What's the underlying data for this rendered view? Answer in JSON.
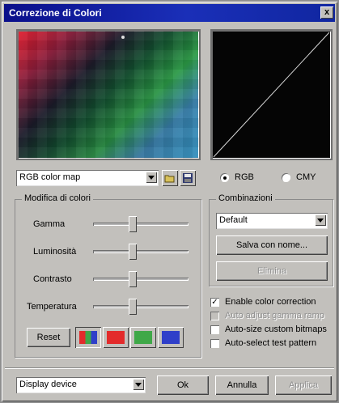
{
  "window": {
    "title": "Correzione di Colori",
    "close_glyph": "x"
  },
  "map_select": {
    "value": "RGB color map"
  },
  "icons": {
    "open": "folder-icon",
    "save": "disk-icon",
    "close": "close-icon",
    "dropdown": "chevron-down-icon"
  },
  "mode": {
    "rgb_label": "RGB",
    "cmy_label": "CMY",
    "selected": "RGB"
  },
  "modifica": {
    "title": "Modifica di colori",
    "sliders": [
      {
        "label": "Gamma",
        "value": 0.5
      },
      {
        "label": "Luminosità",
        "value": 0.5
      },
      {
        "label": "Contrasto",
        "value": 0.5
      },
      {
        "label": "Temperatura",
        "value": 0.5
      }
    ],
    "reset_label": "Reset",
    "swatches": [
      {
        "name": "all-channels",
        "selected": true
      },
      {
        "name": "red",
        "color": "#e32b2b"
      },
      {
        "name": "green",
        "color": "#3fa848"
      },
      {
        "name": "blue",
        "color": "#2f3fc9"
      }
    ]
  },
  "combinazioni": {
    "title": "Combinazioni",
    "select_value": "Default",
    "save_label": "Salva con nome...",
    "delete_label": "Elimina"
  },
  "options": [
    {
      "label": "Enable color correction",
      "checked": true,
      "enabled": true
    },
    {
      "label": "Auto adjust gamma ramp",
      "checked": false,
      "enabled": false
    },
    {
      "label": "Auto-size custom bitmaps",
      "checked": false,
      "enabled": true
    },
    {
      "label": "Auto-select test pattern",
      "checked": false,
      "enabled": true
    }
  ],
  "footer": {
    "device_value": "Display device",
    "ok_label": "Ok",
    "cancel_label": "Annulla",
    "apply_label": "Applica"
  },
  "colors": {
    "titlebar": "#1a2fb8",
    "face": "#c2c0bc"
  }
}
